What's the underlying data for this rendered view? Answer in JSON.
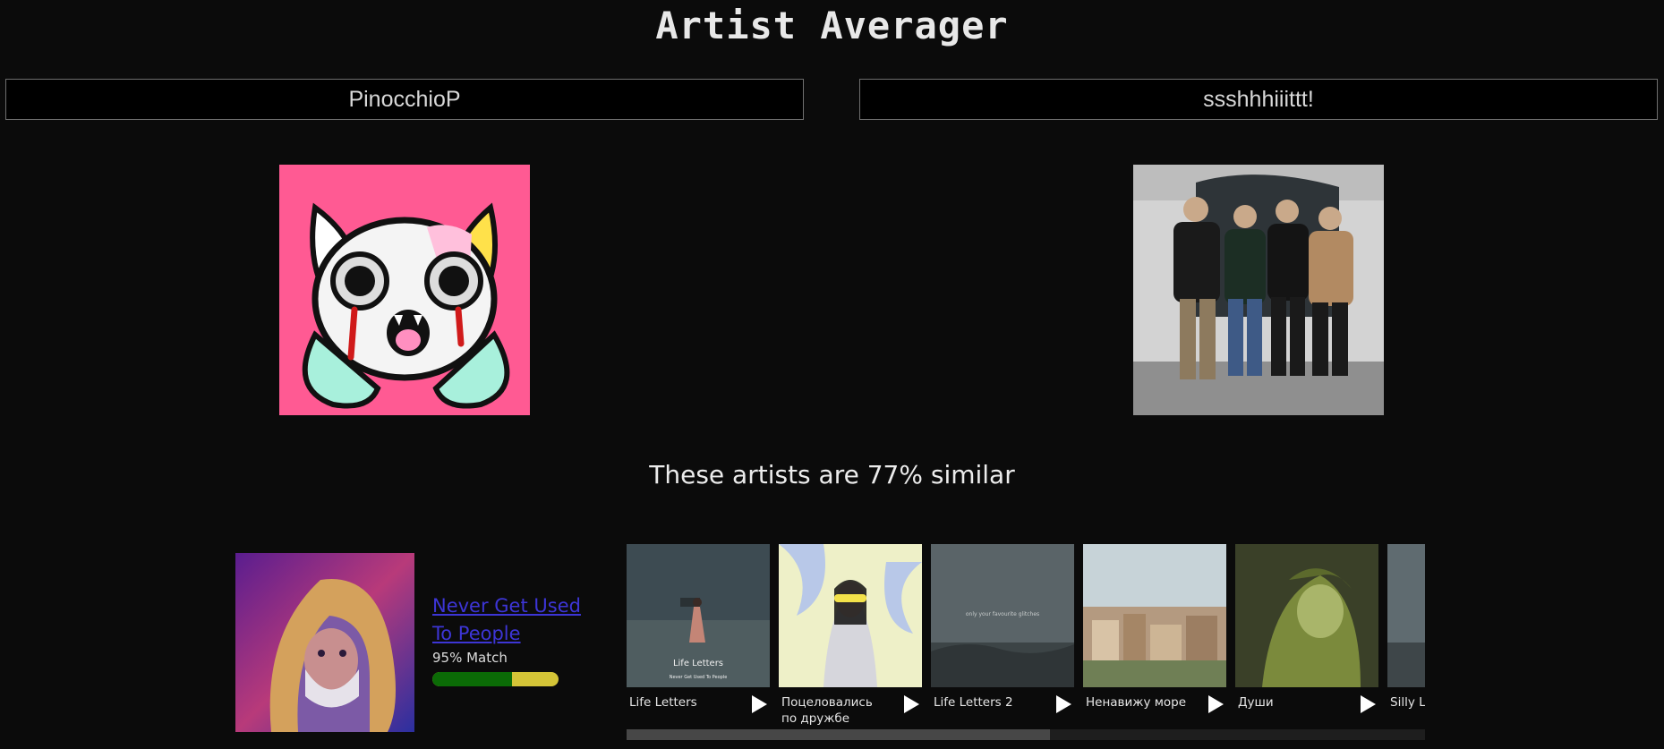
{
  "app": {
    "title": "Artist Averager"
  },
  "artists": [
    {
      "value": "PinocchioP"
    },
    {
      "value": "ssshhhiiittt!"
    }
  ],
  "similarity_text": "These artists are 77% similar",
  "featured_song": {
    "title": "Never Get Used To People",
    "match_label": "95% Match",
    "match_fraction": 0.63
  },
  "carousel": {
    "scroll_fraction": 0.53,
    "items": [
      {
        "title": "Life Letters",
        "cover_text": "Life Letters",
        "cover_subtext": "Never Get Used To People"
      },
      {
        "title": "Поцеловались по дружбе"
      },
      {
        "title": "Life Letters 2",
        "cover_text": "only your favourite glitches"
      },
      {
        "title": "Ненавижу море"
      },
      {
        "title": "Души"
      },
      {
        "title": "Silly Letters"
      }
    ]
  },
  "colors": {
    "background": "#0b0b0b",
    "link": "#3d35d6",
    "match_fill": "#0b6b06",
    "match_rest": "#d4c437",
    "pink": "#ff5a93"
  },
  "icons": {
    "play": "play-icon"
  }
}
